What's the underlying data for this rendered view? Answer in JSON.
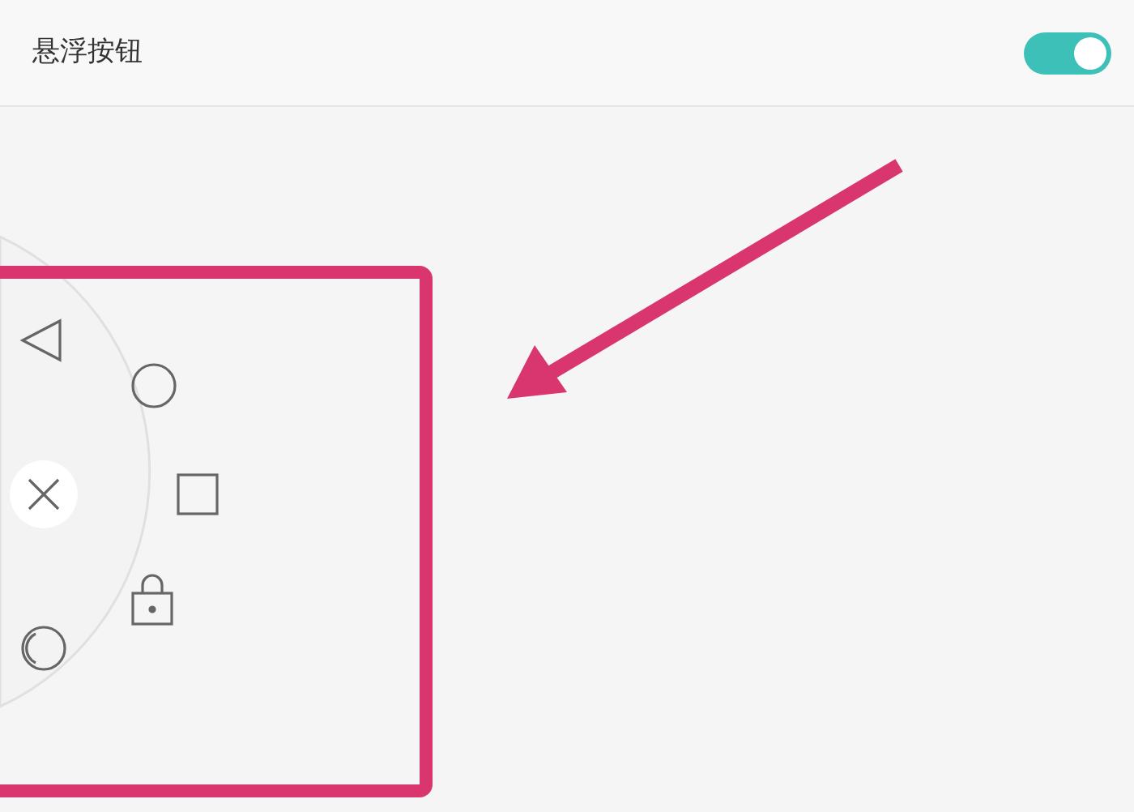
{
  "settings": [
    {
      "label": "悬浮按钮",
      "on": true
    }
  ]
}
